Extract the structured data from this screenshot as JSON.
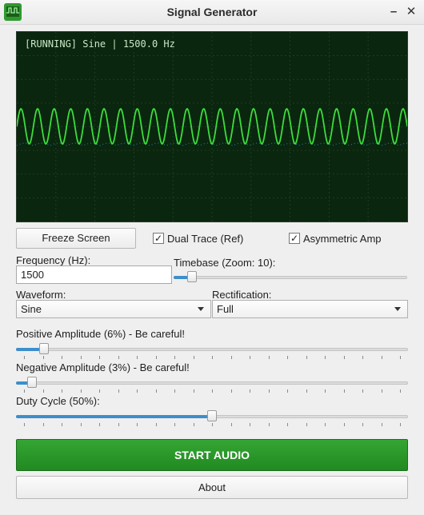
{
  "window": {
    "title": "Signal Generator",
    "minimize_glyph": "–",
    "close_glyph": "✕"
  },
  "scope": {
    "status_text": "[RUNNING] Sine | 1500.0 Hz",
    "trace_color": "#3ddc3d",
    "ref_color": "#2a6fa8",
    "background": "#0a260e"
  },
  "controls": {
    "freeze_label": "Freeze Screen",
    "dual_trace": {
      "label": "Dual Trace (Ref)",
      "checked": true
    },
    "asymmetric_amp": {
      "label": "Asymmetric Amp",
      "checked": true
    },
    "frequency": {
      "label": "Frequency (Hz):",
      "value": "1500"
    },
    "timebase": {
      "label": "Timebase (Zoom: 10):",
      "value_fraction": 0.06
    },
    "waveform": {
      "label": "Waveform:",
      "selected": "Sine"
    },
    "rectification": {
      "label": "Rectification:",
      "selected": "Full"
    },
    "positive_amplitude": {
      "label": "Positive Amplitude (6%) - Be careful!",
      "value_fraction": 0.06
    },
    "negative_amplitude": {
      "label": "Negative Amplitude (3%) - Be careful!",
      "value_fraction": 0.03
    },
    "duty_cycle": {
      "label": "Duty Cycle (50%):",
      "value_fraction": 0.5
    },
    "start_label": "START AUDIO",
    "about_label": "About"
  },
  "colors": {
    "accent": "#3e8ecb",
    "start_button": "#2a992a"
  }
}
